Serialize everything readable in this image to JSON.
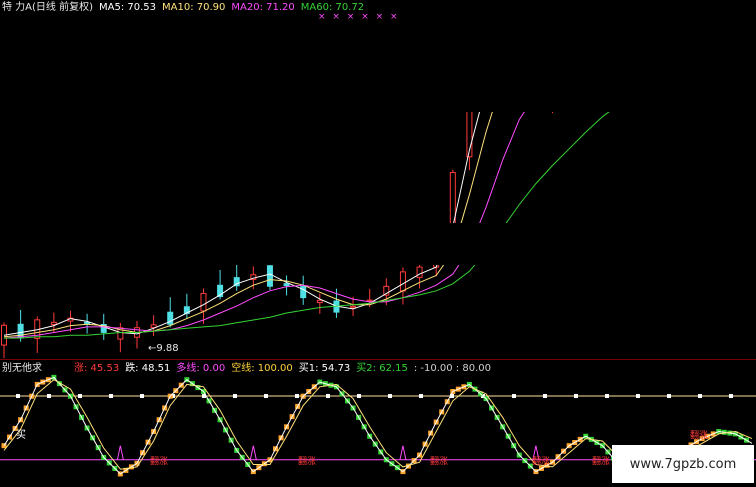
{
  "colors": {
    "up": "#ff3a3a",
    "down": "#4fe0e6",
    "ma5": "#ffffff",
    "ma10": "#ffe27a",
    "ma20": "#ff4dff",
    "ma60": "#35d335",
    "jump": "#ff3a3a",
    "fall": "#ffffff",
    "multi": "#ff4dff",
    "empty": "#ffd23a",
    "buy1": "#ffffff",
    "buy2": "#35d335",
    "range": "#cfcfcf",
    "level_line": "#ffe0a0",
    "low_line": "#ff4dff"
  },
  "main_legend": {
    "title": "特 力A(日线 前复权)",
    "ma5": "MA5: 70.53",
    "ma10": "MA10: 70.90",
    "ma20": "MA20: 71.20",
    "ma60": "MA60: 70.72"
  },
  "low_marker": "←9.88",
  "marks_row": "× × × × × ×",
  "sub_legend": {
    "name": "别无他求",
    "jump": "涨: 45.53",
    "fall": "跌: 48.51",
    "multi": "多线: 0.00",
    "empty": "空线: 100.00",
    "buy1": "买1: 54.73",
    "buy2": "买2: 62.15",
    "range": ": -10.00 : 80.00"
  },
  "sub_labels": {
    "buy_left": "买",
    "signals": [
      "翻涨",
      "翻涨",
      "翻涨",
      "翻涨",
      "翻涨",
      "翻涨"
    ]
  },
  "watermark": "www.7gpzb.com",
  "chart_data": [
    {
      "type": "line",
      "panel": "price",
      "series": [
        {
          "name": "MA5",
          "values": [
            10.2,
            10.4,
            10.6,
            10.9,
            11.4,
            11.2,
            10.8,
            10.4,
            10.3,
            10.7,
            11.2,
            11.8,
            12.4,
            13.1,
            13.9,
            14.3,
            14.6,
            14.0,
            13.5,
            12.8,
            12.3,
            12.1,
            12.5,
            13.2,
            13.9,
            14.6,
            15.1,
            18.0,
            23.5,
            28.0,
            30.8,
            29.6,
            27.5,
            27.0,
            28.5,
            30.2,
            30.7,
            30.3,
            29.8,
            29.5,
            29.8,
            29.2,
            28.6,
            28.5,
            28.9,
            28.3
          ]
        },
        {
          "name": "MA10",
          "values": [
            10.1,
            10.2,
            10.4,
            10.6,
            10.9,
            11.0,
            10.9,
            10.6,
            10.4,
            10.5,
            10.9,
            11.4,
            11.9,
            12.5,
            13.2,
            13.8,
            14.2,
            14.1,
            13.8,
            13.3,
            12.8,
            12.4,
            12.4,
            12.8,
            13.4,
            14.0,
            14.5,
            16.2,
            20.3,
            24.8,
            28.6,
            29.7,
            28.6,
            27.6,
            27.9,
            29.2,
            30.1,
            30.3,
            30.0,
            29.7,
            29.7,
            29.4,
            28.9,
            28.7,
            28.8,
            28.5
          ]
        },
        {
          "name": "MA20",
          "values": [
            10.0,
            10.1,
            10.2,
            10.4,
            10.6,
            10.8,
            10.8,
            10.7,
            10.6,
            10.5,
            10.6,
            10.9,
            11.3,
            11.8,
            12.3,
            12.9,
            13.4,
            13.7,
            13.8,
            13.6,
            13.2,
            12.8,
            12.6,
            12.6,
            12.9,
            13.3,
            13.8,
            14.6,
            16.4,
            19.4,
            22.8,
            25.7,
            27.5,
            27.9,
            27.9,
            28.4,
            29.1,
            29.6,
            29.8,
            29.8,
            29.8,
            29.6,
            29.3,
            29.0,
            28.9,
            28.7
          ]
        },
        {
          "name": "MA60",
          "values": [
            10.0,
            10.0,
            10.1,
            10.1,
            10.2,
            10.2,
            10.3,
            10.4,
            10.4,
            10.5,
            10.6,
            10.7,
            10.8,
            10.9,
            11.1,
            11.3,
            11.5,
            11.8,
            12.0,
            12.2,
            12.3,
            12.4,
            12.5,
            12.7,
            12.9,
            13.1,
            13.4,
            13.9,
            14.8,
            16.2,
            17.9,
            19.6,
            21.1,
            22.4,
            23.6,
            24.8,
            25.9,
            26.8,
            27.6,
            28.2,
            28.6,
            28.9,
            29.1,
            29.2,
            29.2,
            29.1
          ]
        }
      ],
      "low_label": "9.88"
    },
    {
      "type": "line",
      "panel": "indicator",
      "ylim": [
        -10,
        80
      ],
      "series": [
        {
          "name": "涨",
          "values": [
            20,
            42,
            72,
            78,
            62,
            35,
            10,
            -4,
            5,
            32,
            62,
            76,
            66,
            42,
            16,
            -2,
            8,
            36,
            62,
            74,
            70,
            52,
            28,
            8,
            -2,
            12,
            40,
            66,
            72,
            60,
            36,
            12,
            -2,
            6,
            20,
            28,
            20,
            4,
            6,
            14,
            10,
            18,
            26,
            32,
            30,
            22
          ]
        },
        {
          "name": "跌",
          "values": [
            16,
            34,
            64,
            76,
            68,
            44,
            18,
            0,
            2,
            24,
            54,
            72,
            70,
            50,
            24,
            4,
            4,
            28,
            54,
            70,
            72,
            60,
            36,
            14,
            2,
            6,
            32,
            58,
            70,
            64,
            44,
            20,
            4,
            2,
            14,
            26,
            24,
            10,
            4,
            10,
            12,
            14,
            22,
            30,
            32,
            26
          ]
        }
      ],
      "levels": [
        54.73,
        62.15
      ]
    }
  ]
}
